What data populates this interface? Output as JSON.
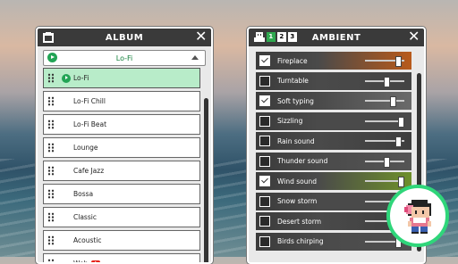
{
  "album": {
    "title": "ALBUM",
    "selected": "Lo-Fi",
    "items": [
      "Lo-Fi",
      "Lo-Fi Chill",
      "Lo-Fi Beat",
      "Lounge",
      "Cafe Jazz",
      "Bossa",
      "Classic",
      "Acoustic",
      "Web"
    ]
  },
  "ambient": {
    "title": "AMBIENT",
    "pages": [
      "1",
      "2",
      "3"
    ],
    "active_page": "1",
    "items": [
      {
        "label": "Fireplace",
        "checked": true,
        "level": 0.85,
        "color": "#b85a1b"
      },
      {
        "label": "Turntable",
        "checked": false,
        "level": 0.55,
        "color": "#444444"
      },
      {
        "label": "Soft typing",
        "checked": true,
        "level": 0.7,
        "color": "#6a6a6a"
      },
      {
        "label": "Sizzling",
        "checked": false,
        "level": 0.9,
        "color": "#4a4a4a"
      },
      {
        "label": "Rain sound",
        "checked": false,
        "level": 0.85,
        "color": "#3e3e3e"
      },
      {
        "label": "Thunder sound",
        "checked": false,
        "level": 0.55,
        "color": "#555555"
      },
      {
        "label": "Wind sound",
        "checked": true,
        "level": 0.9,
        "color": "#6e8f2a"
      },
      {
        "label": "Snow storm",
        "checked": false,
        "level": 0.85,
        "color": "#4a4a4a"
      },
      {
        "label": "Desert storm",
        "checked": false,
        "level": 0.85,
        "color": "#3f3f3f"
      },
      {
        "label": "Birds chirping",
        "checked": false,
        "level": 0.85,
        "color": "#505050"
      }
    ]
  },
  "colors": {
    "accent": "#2fd67a",
    "selected_row": "#b8ecc9",
    "header": "#3a3a3a"
  },
  "icons": {
    "album_header": "album-icon",
    "ambient_header": "pixel-icon",
    "close": "close-icon",
    "avatar": "pixel-character-avatar"
  }
}
